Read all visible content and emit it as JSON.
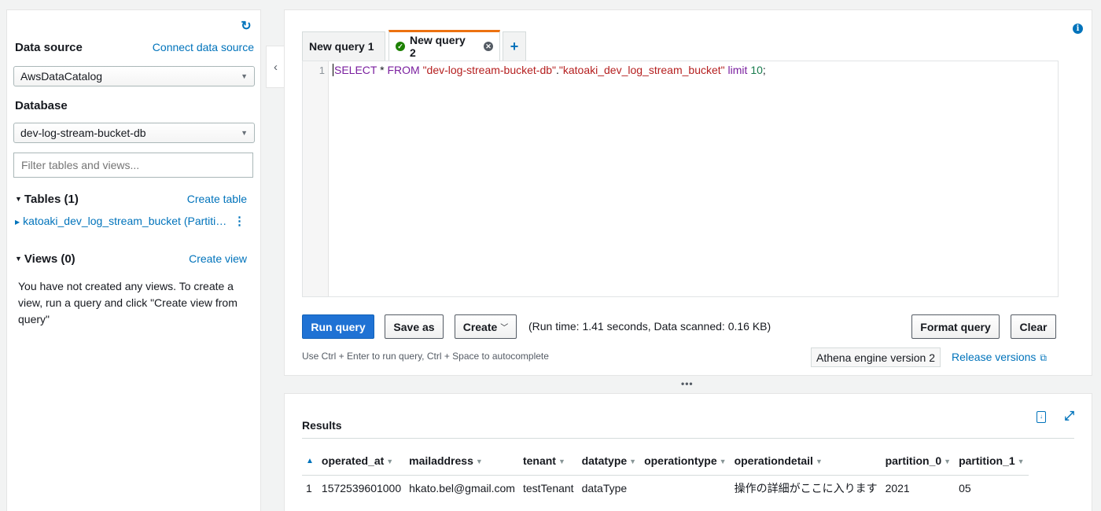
{
  "sidebar": {
    "data_source_label": "Data source",
    "connect_link": "Connect data source",
    "data_source_value": "AwsDataCatalog",
    "database_label": "Database",
    "database_value": "dev-log-stream-bucket-db",
    "filter_placeholder": "Filter tables and views...",
    "tables_label": "Tables (1)",
    "create_table_link": "Create table",
    "table_item": "katoaki_dev_log_stream_bucket (Partiti…",
    "views_label": "Views (0)",
    "create_view_link": "Create view",
    "views_message": "You have not created any views. To create a view, run a query and click \"Create view from query\""
  },
  "tabs": {
    "tab1": "New query 1",
    "tab2": "New query 2",
    "add": "+"
  },
  "editor": {
    "line_number": "1",
    "code": {
      "kw1": "SELECT",
      "p1": " * ",
      "kw2": "FROM",
      "p2": " ",
      "s1": "\"dev-log-stream-bucket-db\"",
      "p3": ".",
      "s2": "\"katoaki_dev_log_stream_bucket\"",
      "p4": " ",
      "kw3": "limit",
      "p5": " ",
      "num": "10",
      "p6": ";"
    }
  },
  "toolbar": {
    "run_label": "Run query",
    "save_as_label": "Save as",
    "create_label": "Create",
    "run_info": "(Run time: 1.41 seconds, Data scanned: 0.16 KB)",
    "format_label": "Format query",
    "clear_label": "Clear",
    "hint": "Use Ctrl + Enter to run query, Ctrl + Space to autocomplete",
    "engine": "Athena engine version 2",
    "release_link": "Release versions"
  },
  "results": {
    "title": "Results",
    "columns": [
      "operated_at",
      "mailaddress",
      "tenant",
      "datatype",
      "operationtype",
      "operationdetail",
      "partition_0",
      "partition_1"
    ],
    "rows": [
      [
        "1",
        "1572539601000",
        "hkato.bel@gmail.com",
        "testTenant",
        "dataType",
        "",
        "操作の詳細がここに入ります",
        "2021",
        "05"
      ]
    ]
  }
}
